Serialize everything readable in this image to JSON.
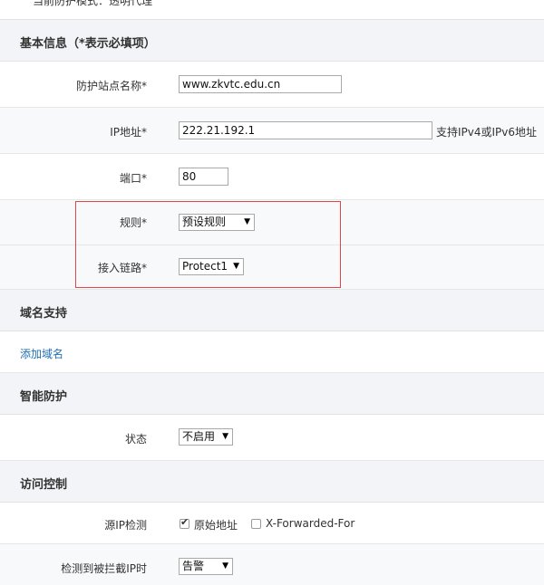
{
  "header": {
    "mode_text": "当前防护模式：透明代理"
  },
  "basic": {
    "title": "基本信息（*表示必填项）",
    "site_name_label": "防护站点名称*",
    "site_name_value": "www.zkvtc.edu.cn",
    "ip_label": "IP地址*",
    "ip_value": "222.21.192.1",
    "ip_hint": "支持IPv4或IPv6地址",
    "port_label": "端口*",
    "port_value": "80",
    "rule_label": "规则*",
    "rule_value": "预设规则",
    "link_label": "接入链路*",
    "link_value": "Protect1"
  },
  "domain": {
    "title": "域名支持",
    "add_link": "添加域名"
  },
  "smart": {
    "title": "智能防护",
    "status_label": "状态",
    "status_value": "不启用"
  },
  "access": {
    "title": "访问控制",
    "source_ip_label": "源IP检测",
    "option_original": "原始地址",
    "option_xff": "X-Forwarded-For",
    "intercept_label": "检测到被拦截IP时",
    "intercept_value": "告警"
  },
  "colors": {
    "section_bg": "#f2f4f7",
    "link": "#1f6fb5",
    "highlight_border": "#e04848"
  }
}
